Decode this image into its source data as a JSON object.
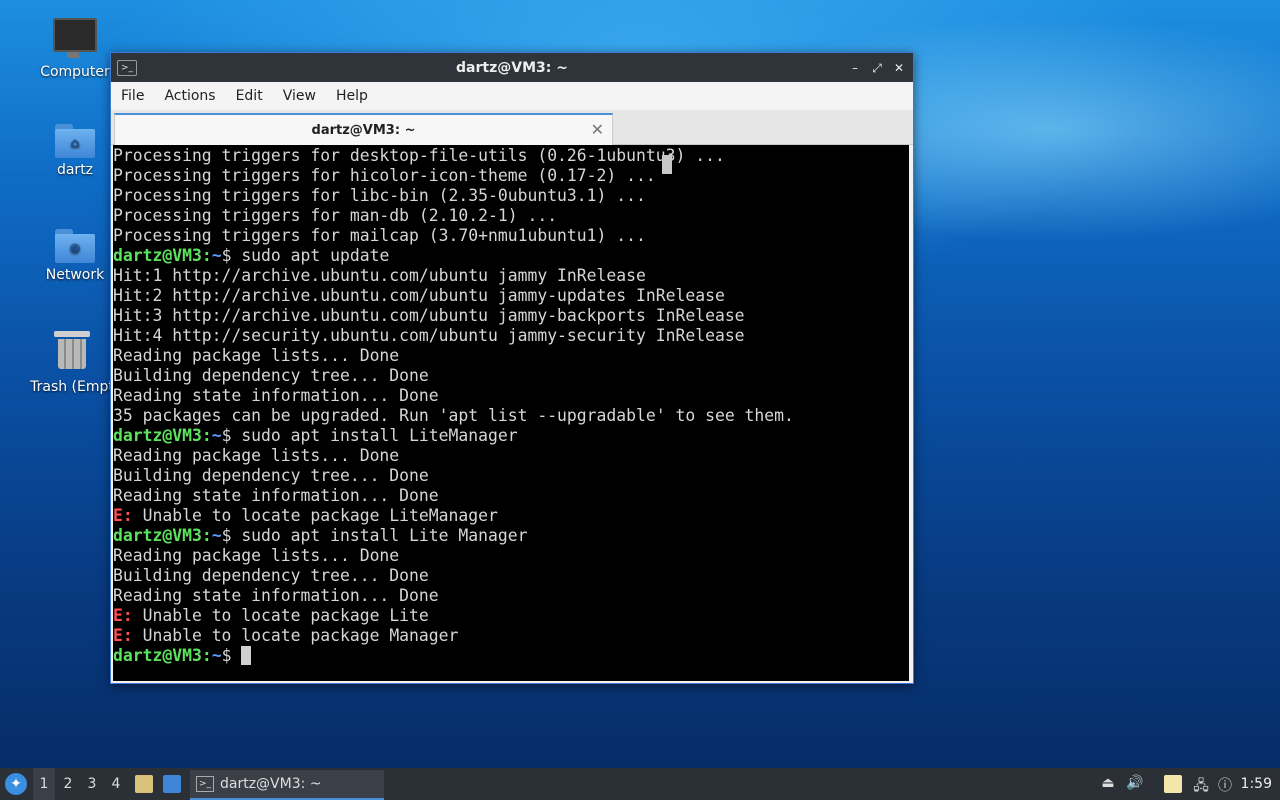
{
  "desktop": {
    "icons": [
      {
        "label": "Computer"
      },
      {
        "label": "dartz"
      },
      {
        "label": "Network"
      },
      {
        "label": "Trash (Empt"
      }
    ]
  },
  "window": {
    "title": "dartz@VM3: ~",
    "menu": [
      "File",
      "Actions",
      "Edit",
      "View",
      "Help"
    ],
    "tab_title": "dartz@VM3: ~",
    "controls": {
      "minimize": "–",
      "maximize": "⤢",
      "close": "✕"
    }
  },
  "terminal": {
    "lines": [
      {
        "kind": "out",
        "text": "Processing triggers for desktop-file-utils (0.26-1ubuntu3) ..."
      },
      {
        "kind": "out",
        "text": "Processing triggers for hicolor-icon-theme (0.17-2) ..."
      },
      {
        "kind": "out",
        "text": "Processing triggers for libc-bin (2.35-0ubuntu3.1) ..."
      },
      {
        "kind": "out",
        "text": "Processing triggers for man-db (2.10.2-1) ..."
      },
      {
        "kind": "out",
        "text": "Processing triggers for mailcap (3.70+nmu1ubuntu1) ..."
      },
      {
        "kind": "cmd",
        "user": "dartz@VM3",
        "path": "~",
        "cmd": "sudo apt update"
      },
      {
        "kind": "out",
        "text": "Hit:1 http://archive.ubuntu.com/ubuntu jammy InRelease"
      },
      {
        "kind": "out",
        "text": "Hit:2 http://archive.ubuntu.com/ubuntu jammy-updates InRelease"
      },
      {
        "kind": "out",
        "text": "Hit:3 http://archive.ubuntu.com/ubuntu jammy-backports InRelease"
      },
      {
        "kind": "out",
        "text": "Hit:4 http://security.ubuntu.com/ubuntu jammy-security InRelease"
      },
      {
        "kind": "out",
        "text": "Reading package lists... Done"
      },
      {
        "kind": "out",
        "text": "Building dependency tree... Done"
      },
      {
        "kind": "out",
        "text": "Reading state information... Done"
      },
      {
        "kind": "out",
        "text": "35 packages can be upgraded. Run 'apt list --upgradable' to see them."
      },
      {
        "kind": "cmd",
        "user": "dartz@VM3",
        "path": "~",
        "cmd": "sudo apt install LiteManager"
      },
      {
        "kind": "out",
        "text": "Reading package lists... Done"
      },
      {
        "kind": "out",
        "text": "Building dependency tree... Done"
      },
      {
        "kind": "out",
        "text": "Reading state information... Done"
      },
      {
        "kind": "err",
        "prefix": "E:",
        "text": " Unable to locate package LiteManager"
      },
      {
        "kind": "cmd",
        "user": "dartz@VM3",
        "path": "~",
        "cmd": "sudo apt install Lite Manager"
      },
      {
        "kind": "out",
        "text": "Reading package lists... Done"
      },
      {
        "kind": "out",
        "text": "Building dependency tree... Done"
      },
      {
        "kind": "out",
        "text": "Reading state information... Done"
      },
      {
        "kind": "err",
        "prefix": "E:",
        "text": " Unable to locate package Lite"
      },
      {
        "kind": "err",
        "prefix": "E:",
        "text": " Unable to locate package Manager"
      },
      {
        "kind": "prompt",
        "user": "dartz@VM3",
        "path": "~",
        "cmd": ""
      }
    ]
  },
  "taskbar": {
    "workspaces": [
      "1",
      "2",
      "3",
      "4"
    ],
    "active_workspace": "1",
    "task_label": "dartz@VM3: ~",
    "clock": "1:59"
  },
  "colors": {
    "prompt_user": "#5fe35f",
    "prompt_path": "#5c9cff",
    "error": "#ff4d4d",
    "accent": "#4a90d9"
  }
}
